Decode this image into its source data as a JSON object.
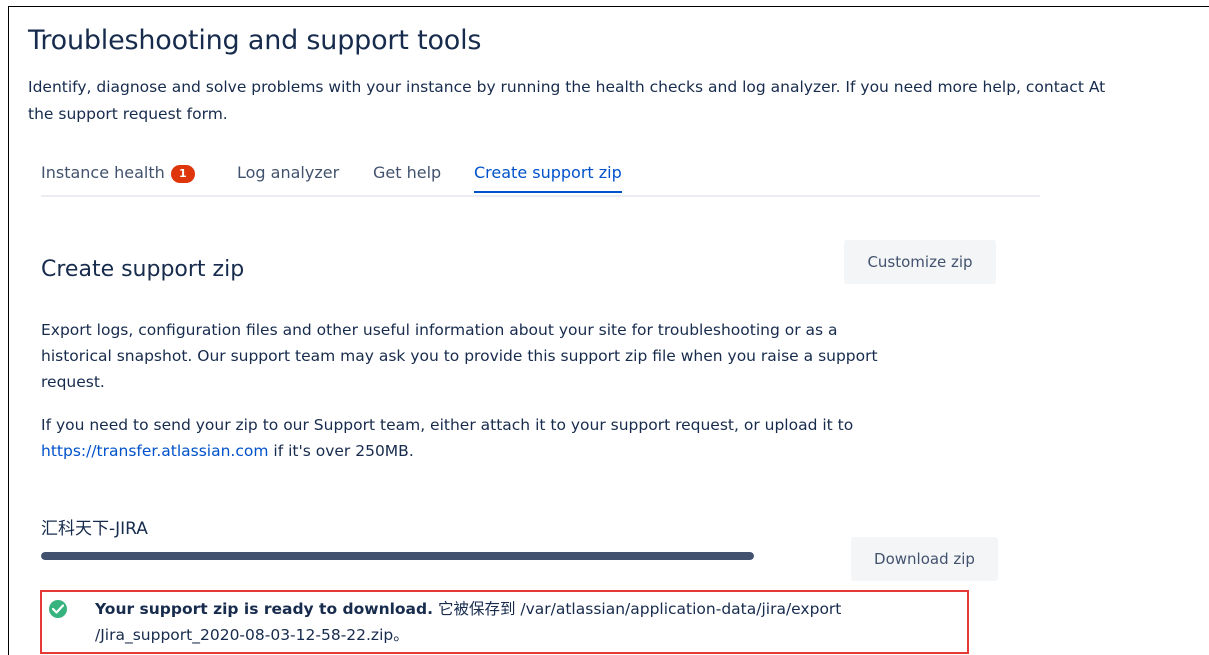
{
  "page": {
    "title": "Troubleshooting and support tools",
    "description_lines": [
      "Identify, diagnose and solve problems with your instance by running the health checks and log analyzer. If you need more help, contact At",
      "the support request form."
    ]
  },
  "tabs": [
    {
      "label": "Instance health",
      "badge": "1",
      "active": false
    },
    {
      "label": "Log analyzer",
      "active": false
    },
    {
      "label": "Get help",
      "active": false
    },
    {
      "label": "Create support zip",
      "active": true
    }
  ],
  "section": {
    "title": "Create support zip",
    "customize_label": "Customize zip",
    "para1_lines": [
      "Export logs, configuration files and other useful information about your site for troubleshooting or as a",
      "historical snapshot. Our support team may ask you to provide this support zip file when you raise a support",
      "request."
    ],
    "para2_line1": "If you need to send your zip to our Support team, either attach it to your support request, or upload it to",
    "para2_link": "https://transfer.atlassian.com",
    "para2_suffix": " if it's over 250MB."
  },
  "zip": {
    "site_name": "汇科天下-JIRA",
    "progress_fraction": 1.0,
    "download_label": "Download zip",
    "ready_strong": "Your support zip is ready to download.",
    "ready_rest_line1": " 它被保存到 /var/atlassian/application-data/jira/export",
    "ready_rest_line2": "/Jira_support_2020-08-03-12-58-22.zip。"
  },
  "colors": {
    "link": "#0052cc",
    "badge": "#de350b",
    "success": "#36b37e",
    "highlight_border": "#e53935"
  }
}
